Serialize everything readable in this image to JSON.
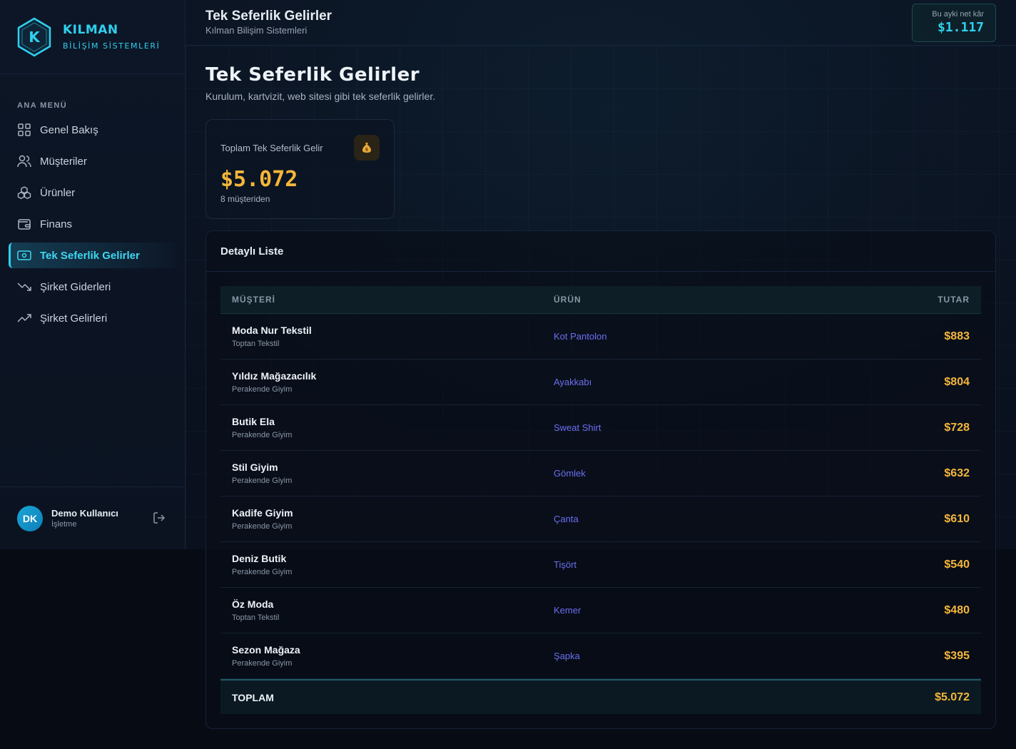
{
  "brand": {
    "name": "KILMAN",
    "sub": "BİLİŞİM SİSTEMLERİ",
    "logo_letter": "K"
  },
  "sidebar": {
    "heading": "ANA MENÜ",
    "items": [
      {
        "label": "Genel Bakış",
        "icon": "grid-icon"
      },
      {
        "label": "Müşteriler",
        "icon": "users-icon"
      },
      {
        "label": "Ürünler",
        "icon": "boxes-icon"
      },
      {
        "label": "Finans",
        "icon": "wallet-icon"
      },
      {
        "label": "Tek Seferlik Gelirler",
        "icon": "banknote-icon",
        "active": true
      },
      {
        "label": "Şirket Giderleri",
        "icon": "trending-down-icon"
      },
      {
        "label": "Şirket Gelirleri",
        "icon": "trending-up-icon"
      }
    ],
    "user": {
      "initials": "DK",
      "name": "Demo Kullanıcı",
      "role": "İşletme"
    }
  },
  "header": {
    "title": "Tek Seferlik Gelirler",
    "subtitle": "Kılman Bilişim Sistemleri",
    "profit_label": "Bu ayki net kâr",
    "profit_value": "$1.117"
  },
  "main": {
    "title": "Tek Seferlik Gelirler",
    "subtitle": "Kurulum, kartvizit, web sitesi gibi tek seferlik gelirler.",
    "stat": {
      "label": "Toplam Tek Seferlik Gelir",
      "icon": "money-bag-icon",
      "value": "$5.072",
      "note": "8 müşteriden"
    },
    "list": {
      "title": "Detaylı Liste",
      "columns": [
        "MÜŞTERİ",
        "ÜRÜN",
        "TUTAR"
      ],
      "rows": [
        {
          "customer": "Moda Nur Tekstil",
          "type": "Toptan Tekstil",
          "product": "Kot Pantolon",
          "amount": "$883"
        },
        {
          "customer": "Yıldız Mağazacılık",
          "type": "Perakende Giyim",
          "product": "Ayakkabı",
          "amount": "$804"
        },
        {
          "customer": "Butik Ela",
          "type": "Perakende Giyim",
          "product": "Sweat Shirt",
          "amount": "$728"
        },
        {
          "customer": "Stil Giyim",
          "type": "Perakende Giyim",
          "product": "Gömlek",
          "amount": "$632"
        },
        {
          "customer": "Kadife Giyim",
          "type": "Perakende Giyim",
          "product": "Çanta",
          "amount": "$610"
        },
        {
          "customer": "Deniz Butik",
          "type": "Perakende Giyim",
          "product": "Tişört",
          "amount": "$540"
        },
        {
          "customer": "Öz Moda",
          "type": "Toptan Tekstil",
          "product": "Kemer",
          "amount": "$480"
        },
        {
          "customer": "Sezon Mağaza",
          "type": "Perakende Giyim",
          "product": "Şapka",
          "amount": "$395"
        }
      ],
      "total_label": "TOPLAM",
      "total_value": "$5.072"
    }
  },
  "colors": {
    "accent": "#2fd0ee",
    "amount": "#f5b63a",
    "product": "#6b6ef0"
  }
}
